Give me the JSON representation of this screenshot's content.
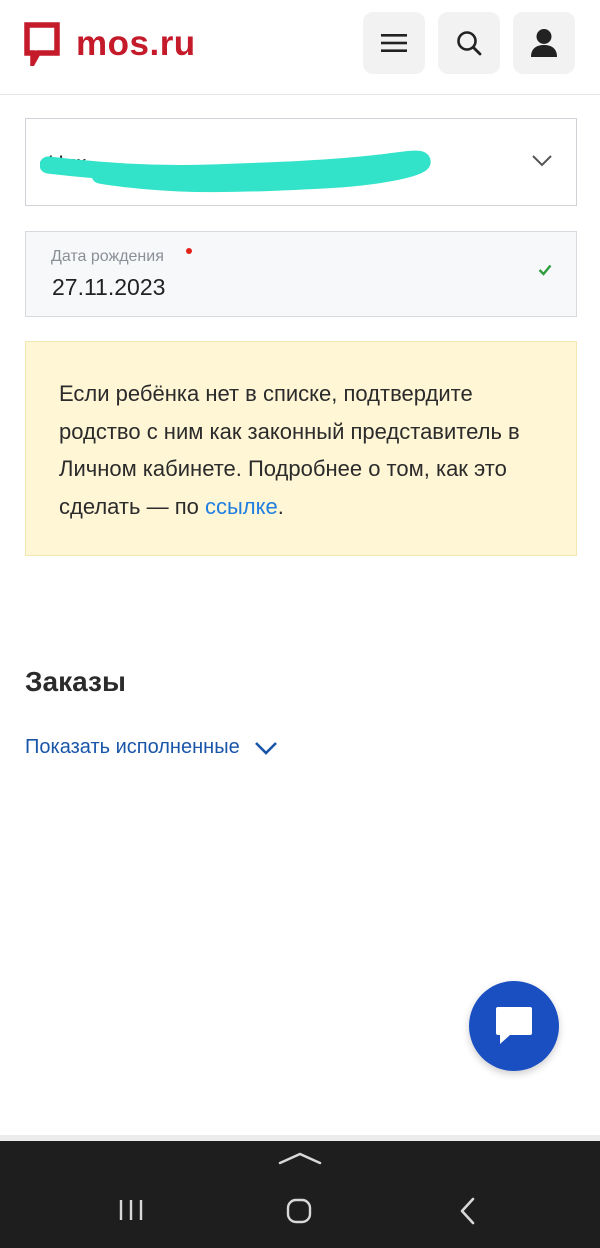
{
  "header": {
    "logo_text": "mos.ru",
    "brand_color": "#c41a2a",
    "menu_icon": "hamburger-icon",
    "search_icon": "search-icon",
    "profile_icon": "user-icon"
  },
  "form": {
    "child_select": {
      "value": "Ник",
      "redacted": true
    },
    "birth_date": {
      "label": "Дата рождения",
      "value": "27.11.2023",
      "required": true,
      "valid": true
    }
  },
  "notice": {
    "text": "Если ребёнка нет в списке, подтвердите родство с ним как законный представитель в Личном кабинете. Подробнее о том, как это сделать — по ",
    "link_text": "ссылке",
    "trailing": ".",
    "background": "#fff6d6",
    "link_color": "#1e7fe0"
  },
  "orders": {
    "title": "Заказы",
    "show_completed": "Показать исполненные"
  },
  "chat_button": {
    "icon": "chat-icon",
    "color": "#1a4fc2"
  },
  "system_nav": {
    "recents_icon": "recents-icon",
    "home_icon": "home-icon",
    "back_icon": "back-icon"
  }
}
